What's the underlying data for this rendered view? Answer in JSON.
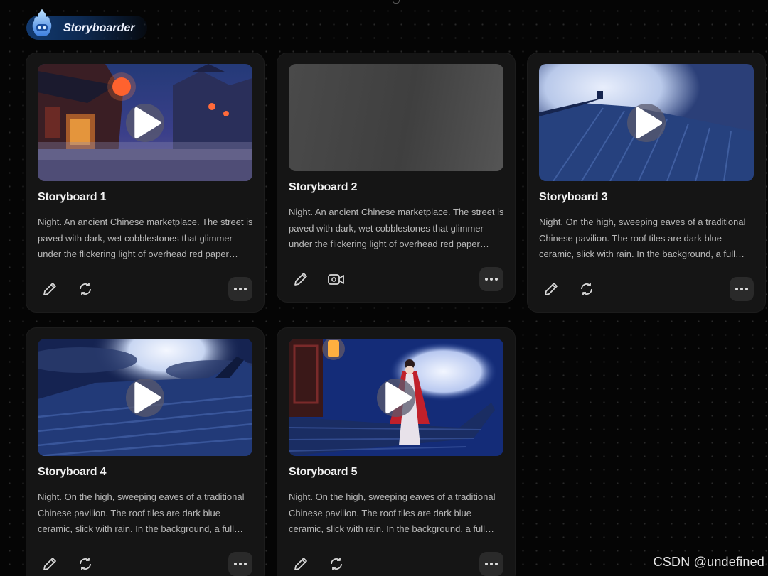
{
  "brand": {
    "name": "Storyboarder",
    "logo_icon": "flame-mascot-icon"
  },
  "cards": [
    {
      "title": "Storyboard 1",
      "description": "Night. An ancient Chinese marketplace. The street is paved with dark, wet cobblestones that glimmer under the flickering light of overhead red paper lanterns.",
      "thumbnail": "marketplace-night",
      "has_video": true,
      "actions": [
        "edit-icon",
        "regenerate-icon",
        "more-icon"
      ]
    },
    {
      "title": "Storyboard 2",
      "description": "Night. An ancient Chinese marketplace. The street is paved with dark, wet cobblestones that glimmer under the flickering light of overhead red paper lanterns.",
      "thumbnail": "loading-placeholder",
      "has_video": false,
      "actions": [
        "edit-icon",
        "video-camera-icon",
        "more-icon"
      ]
    },
    {
      "title": "Storyboard 3",
      "description": "Night. On the high, sweeping eaves of a traditional Chinese pavilion. The roof tiles are dark blue ceramic, slick with rain. In the background, a full moon glows.",
      "thumbnail": "roof-moon",
      "has_video": true,
      "actions": [
        "edit-icon",
        "regenerate-icon",
        "more-icon"
      ]
    },
    {
      "title": "Storyboard 4",
      "description": "Night. On the high, sweeping eaves of a traditional Chinese pavilion. The roof tiles are dark blue ceramic, slick with rain. In the background, a full moon glows.",
      "thumbnail": "roof-clouds",
      "has_video": true,
      "actions": [
        "edit-icon",
        "regenerate-icon",
        "more-icon"
      ]
    },
    {
      "title": "Storyboard 5",
      "description": "Night. On the high, sweeping eaves of a traditional Chinese pavilion. The roof tiles are dark blue ceramic, slick with rain. In the background, a full moon glows.",
      "thumbnail": "girl-on-roof",
      "has_video": true,
      "actions": [
        "edit-icon",
        "regenerate-icon",
        "more-icon"
      ]
    }
  ],
  "watermark": "CSDN @undefined",
  "colors": {
    "background": "#050505",
    "card": "#151515",
    "text": "#f2f2f2",
    "muted": "#b9b9b9",
    "brand_blue": "#123a70"
  }
}
